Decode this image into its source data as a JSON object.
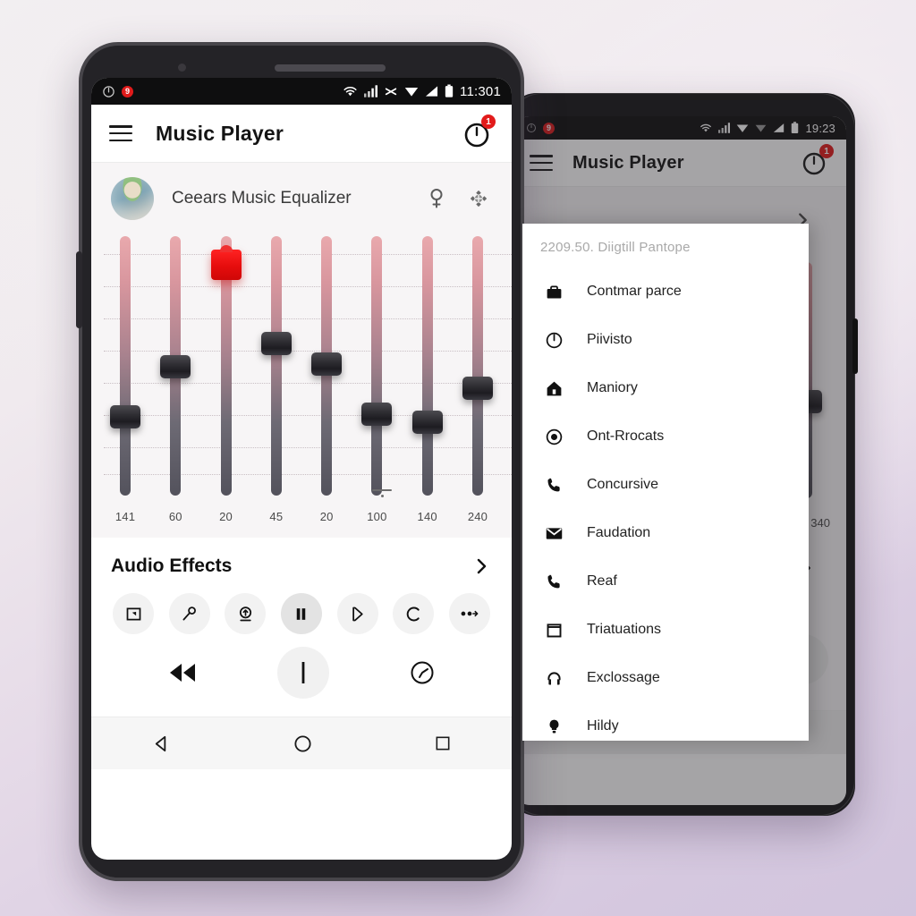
{
  "background": {
    "top_color": "#f3f0f1",
    "bottom_color": "#d2c5de"
  },
  "left_phone": {
    "status_bar": {
      "time": "11:301",
      "left_icons": [
        "power-icon",
        "notification-badge-icon"
      ],
      "badge_text": "9",
      "right_icons": [
        "wifi-icon",
        "signal-bars-icon",
        "wifi-off-icon",
        "wifi-triangle-icon",
        "signal-triangle-icon",
        "battery-icon"
      ]
    },
    "app_bar": {
      "menu_icon": "hamburger-menu-icon",
      "title": "Music Player",
      "timer_icon": "timer-icon",
      "timer_badge": "1"
    },
    "equalizer": {
      "avatar": "user-avatar",
      "title": "Ceears Music Equalizer",
      "head_icons": [
        "female-symbol-icon",
        "snowflake-icon"
      ],
      "bands": [
        {
          "label": "141",
          "position_pct": 64
        },
        {
          "label": "60",
          "position_pct": 45
        },
        {
          "label": "20",
          "position_pct": 5
        },
        {
          "label": "45",
          "position_pct": 36
        },
        {
          "label": "20",
          "position_pct": 44
        },
        {
          "label": "100",
          "position_pct": 63
        },
        {
          "label": "140",
          "position_pct": 66
        },
        {
          "label": "240",
          "position_pct": 53
        }
      ],
      "active_band_index": 2,
      "gridline_count": 8
    },
    "audio_effects": {
      "title": "Audio Effects",
      "chevron_icon": "chevron-right-icon"
    },
    "effect_buttons": [
      {
        "icon": "export-box-icon"
      },
      {
        "icon": "key-icon"
      },
      {
        "icon": "upload-circle-icon"
      },
      {
        "icon": "pause-icon",
        "emphasized": true
      },
      {
        "icon": "play-outline-icon"
      },
      {
        "icon": "loop-c-icon"
      },
      {
        "icon": "dots-arrow-icon"
      }
    ],
    "playback": [
      {
        "icon": "rewind-icon"
      },
      {
        "icon": "pause-bar-icon",
        "big": true
      },
      {
        "icon": "clock-dial-icon"
      }
    ],
    "nav_bar": {
      "back_icon": "back-triangle-icon",
      "home_icon": "home-circle-icon",
      "recents_icon": "recents-square-icon"
    }
  },
  "right_phone": {
    "status_bar": {
      "time": "19:23",
      "badge_text": "9",
      "right_icons": [
        "wifi-icon",
        "signal-bars-icon",
        "wifi-triangle-icon",
        "wifi-grey-icon",
        "signal-triangle-icon",
        "battery-icon"
      ]
    },
    "app_bar": {
      "menu_icon": "hamburger-menu-icon",
      "title": "Music Player",
      "timer_icon": "timer-icon",
      "timer_badge": "1"
    },
    "drawer": {
      "header": "2209.50. Diigtill Pantope",
      "items": [
        {
          "icon": "briefcase-icon",
          "label": "Contmar parce"
        },
        {
          "icon": "power-clock-icon",
          "label": "Piivisto"
        },
        {
          "icon": "home-lock-icon",
          "label": "Maniory"
        },
        {
          "icon": "target-icon",
          "label": "Ont-Rrocats"
        },
        {
          "icon": "phone-icon",
          "label": "Concursive"
        },
        {
          "icon": "mail-icon",
          "label": "Faudation"
        },
        {
          "icon": "phone-icon",
          "label": "Reaf"
        },
        {
          "icon": "square-icon",
          "label": "Triatuations"
        },
        {
          "icon": "headset-icon",
          "label": "Exclossage"
        },
        {
          "icon": "bulb-icon",
          "label": "Hildy"
        }
      ]
    },
    "equalizer": {
      "visible_band_label": "340",
      "chevron_icon": "chevron-right-icon"
    },
    "nav_bar": {
      "back_icon": "back-triangle-icon",
      "home_icon": "home-circle-icon",
      "recents_icon": "recents-square-icon"
    }
  }
}
